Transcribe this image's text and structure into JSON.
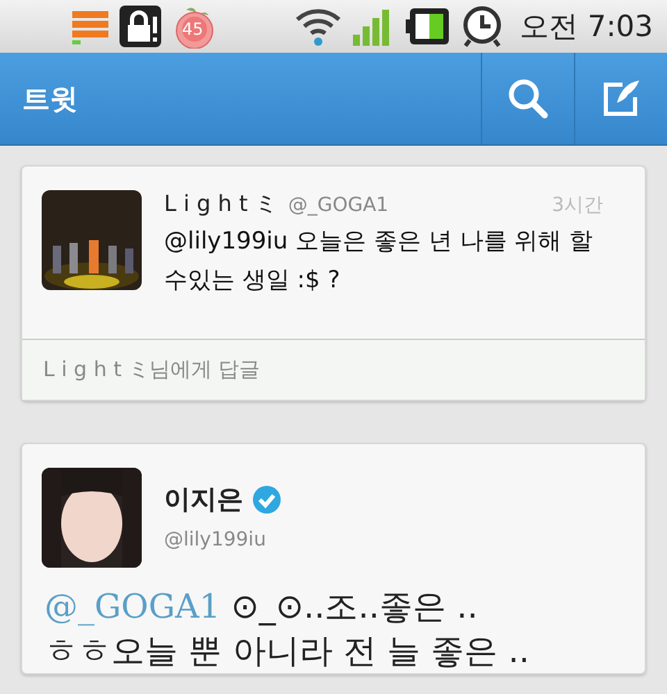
{
  "status_bar": {
    "badge": "45",
    "time": "오전 7:03"
  },
  "header": {
    "title": "트윗"
  },
  "tweets": [
    {
      "kind": "context",
      "name": "L i g h t ミ",
      "handle": "@_GOGA1",
      "time": "3시간",
      "text": "@lily199iu 오늘은 좋은 년 나를 위해 할 수있는 생일 :$ ?",
      "reply_prompt": "L i g h t ミ님에게 답글"
    },
    {
      "kind": "main",
      "name": "이지은",
      "verified": true,
      "handle": "@lily199iu",
      "mention": "@_GOGA1",
      "lines": [
        "⊙_⊙..조..좋은 ..",
        "ㅎㅎ오늘 뿐 아니라 전 늘 좋은 .."
      ]
    }
  ]
}
